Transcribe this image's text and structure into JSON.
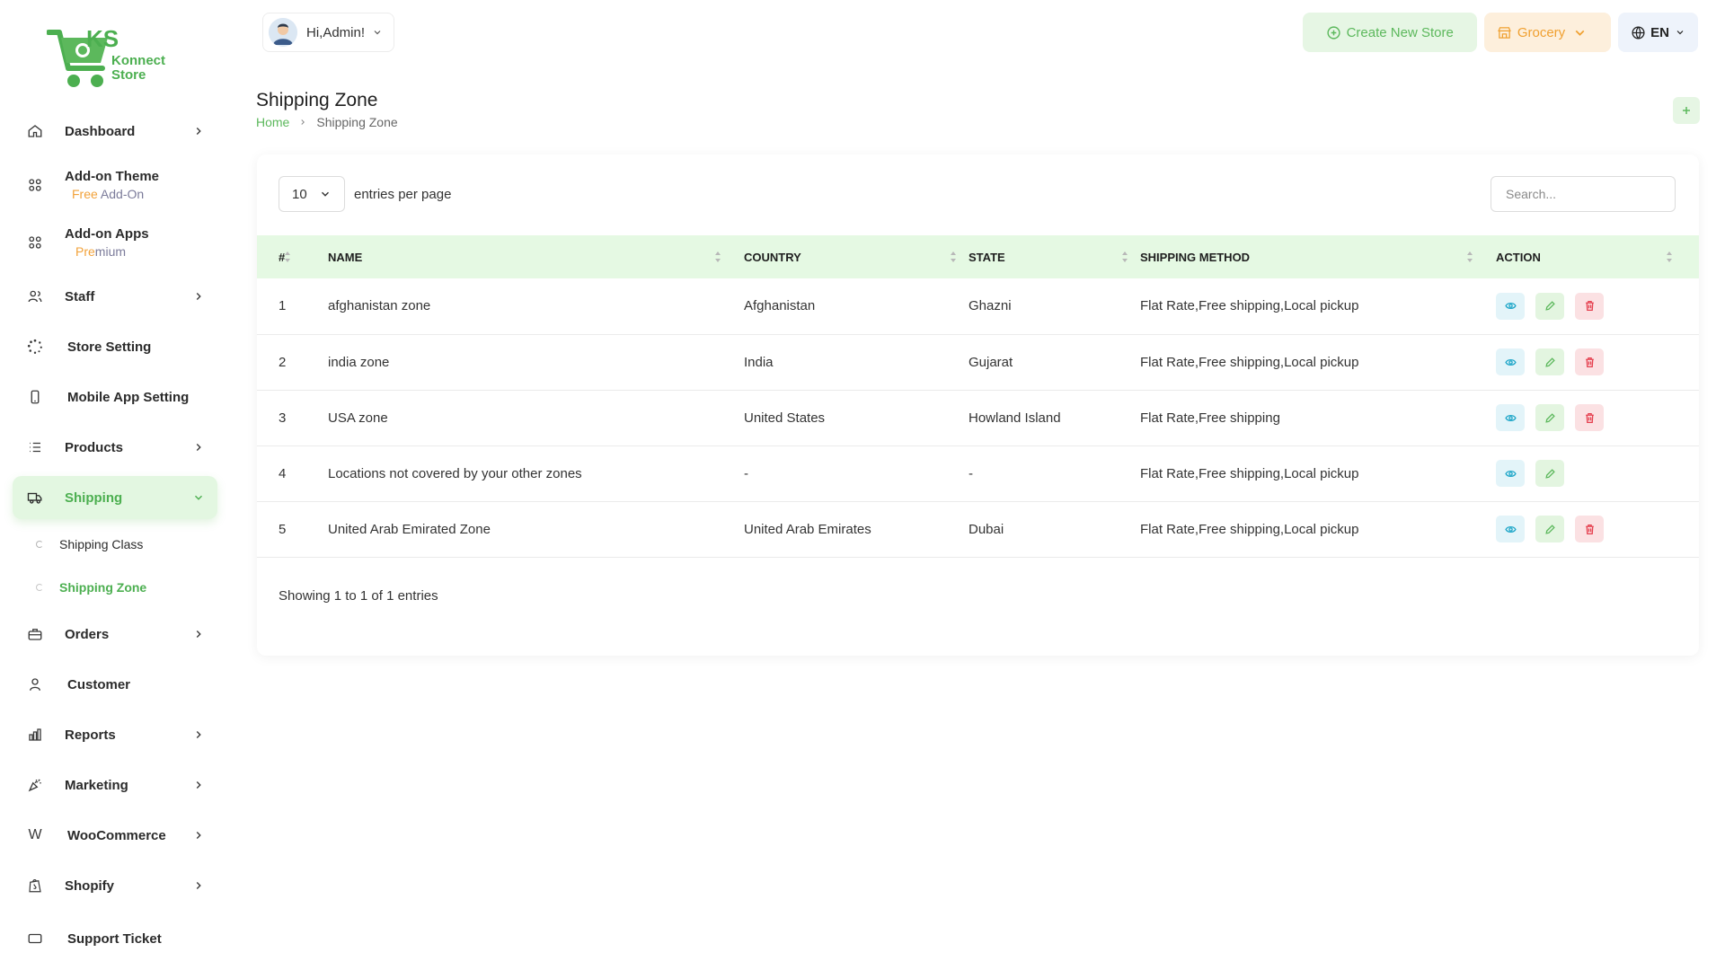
{
  "app": {
    "logo_text": "KS Konnect Store",
    "accent": "#5cb85c",
    "accent_dark": "#4caf50",
    "warning": "#f0a030",
    "danger": "#e5404f",
    "info": "#21a7c9"
  },
  "sidebar": {
    "items": [
      {
        "label": "Dashboard",
        "icon": "home-icon",
        "chevron": true
      },
      {
        "label": "Add-on Theme",
        "icon": "grid-icon",
        "tag": "Free Add-On"
      },
      {
        "label": "Add-on Apps",
        "icon": "grid-icon",
        "tag": "Premium"
      },
      {
        "label": "Staff",
        "icon": "users-icon",
        "chevron": true
      },
      {
        "label": "Store Setting",
        "icon": "loader-icon"
      },
      {
        "label": "Mobile App Setting",
        "icon": "mobile-icon"
      },
      {
        "label": "Products",
        "icon": "list-icon",
        "chevron": true
      },
      {
        "label": "Shipping",
        "icon": "truck-icon",
        "active": true,
        "expanded": true
      },
      {
        "label": "Orders",
        "icon": "briefcase-icon",
        "chevron": true
      },
      {
        "label": "Customer",
        "icon": "user-icon"
      },
      {
        "label": "Reports",
        "icon": "bar-chart-icon",
        "chevron": true
      },
      {
        "label": "Marketing",
        "icon": "confetti-icon",
        "chevron": true
      },
      {
        "label": "WooCommerce",
        "icon": "woo-icon",
        "chevron": true
      },
      {
        "label": "Shopify",
        "icon": "shopify-icon",
        "chevron": true
      },
      {
        "label": "Support Ticket",
        "icon": "ticket-icon"
      }
    ],
    "shipping_sub": [
      {
        "label": "Shipping Class",
        "active": false
      },
      {
        "label": "Shipping Zone",
        "active": true
      }
    ],
    "tag_free_a": "Free",
    "tag_free_b": " Add-On",
    "tag_premium_a": "Pre",
    "tag_premium_b": "mium"
  },
  "topbar": {
    "greeting": "Hi,Admin!",
    "create_store": "Create New Store",
    "store_select": "Grocery",
    "language": "EN"
  },
  "page": {
    "title": "Shipping Zone",
    "breadcrumb": [
      "Home",
      "Shipping Zone"
    ]
  },
  "table": {
    "entries_value": "10",
    "entries_label": "entries per page",
    "search_placeholder": "Search...",
    "columns": [
      "#",
      "NAME",
      "COUNTRY",
      "STATE",
      "SHIPPING METHOD",
      "ACTION"
    ],
    "rows": [
      {
        "num": "1",
        "name": "afghanistan zone",
        "country": "Afghanistan",
        "state": "Ghazni",
        "method": "Flat Rate,Free shipping,Local pickup",
        "deletable": true
      },
      {
        "num": "2",
        "name": "india zone",
        "country": "India",
        "state": "Gujarat",
        "method": "Flat Rate,Free shipping,Local pickup",
        "deletable": true
      },
      {
        "num": "3",
        "name": "USA zone",
        "country": "United States",
        "state": "Howland Island",
        "method": "Flat Rate,Free shipping",
        "deletable": true
      },
      {
        "num": "4",
        "name": "Locations not covered by your other zones",
        "country": "-",
        "state": "-",
        "method": "Flat Rate,Free shipping,Local pickup",
        "deletable": false
      },
      {
        "num": "5",
        "name": "United Arab Emirated Zone",
        "country": "United Arab Emirates",
        "state": "Dubai",
        "method": "Flat Rate,Free shipping,Local pickup",
        "deletable": true
      }
    ],
    "footer": "Showing 1 to 1 of 1 entries"
  }
}
